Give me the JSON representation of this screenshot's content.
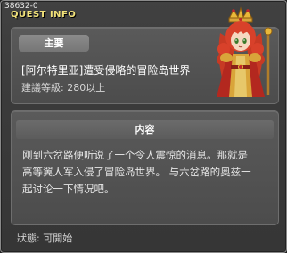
{
  "window": {
    "quest_id": "38632-0",
    "title": "QUEST INFO"
  },
  "quest": {
    "badge": "主要",
    "title": "[阿尔特里亚]遭受侵略的冒险岛世界",
    "level": "建議等級: 280以上"
  },
  "content": {
    "header": "内容",
    "lines": [
      "刚到六岔路便听说了一个令人震惊的消息。那就是",
      "高等翼人军入侵了冒险岛世界。 与六岔路的奥兹一",
      "起讨论一下情况吧。"
    ]
  },
  "status": "狀態:  可開始",
  "colors": {
    "title_yellow": "#f2e27a",
    "hair_red": "#d8412a",
    "robe_gold": "#d9a53a"
  }
}
